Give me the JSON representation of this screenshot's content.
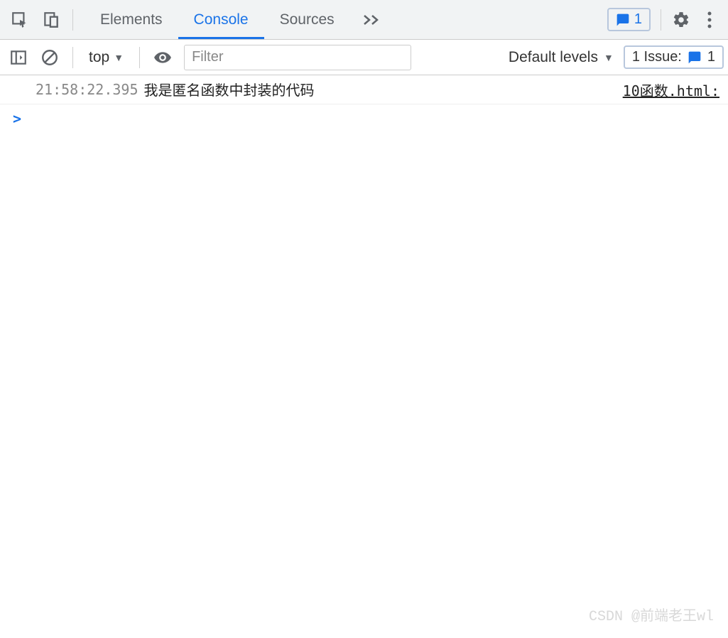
{
  "toolbar": {
    "tabs": [
      "Elements",
      "Console",
      "Sources"
    ],
    "active_tab": 1,
    "message_count": "1"
  },
  "subbar": {
    "context": "top",
    "filter_placeholder": "Filter",
    "levels_label": "Default levels",
    "issues_label": "1 Issue:",
    "issues_count": "1"
  },
  "log": {
    "timestamp": "21:58:22.395",
    "message": "我是匿名函数中封装的代码",
    "source": "10函数.html:"
  },
  "prompt": ">",
  "watermark": "CSDN @前端老王wl"
}
